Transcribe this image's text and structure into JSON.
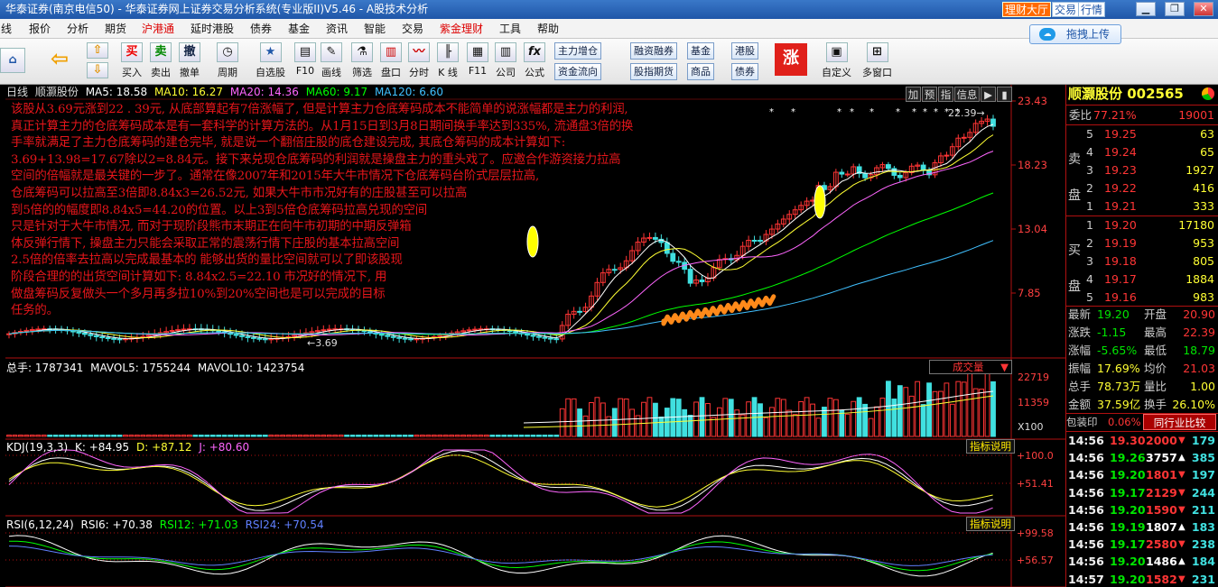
{
  "window": {
    "title": "华泰证券(南京电信50) - 华泰证券网上证券交易分析系统(专业版II)V5.46 - A股技术分析",
    "buttons": [
      "理财大厅",
      "交易",
      "行情"
    ]
  },
  "menu": [
    "线",
    "报价",
    "分析",
    "期货",
    "沪港通",
    "延时港股",
    "债券",
    "基金",
    "资讯",
    "智能",
    "交易",
    "紫金理财",
    "工具",
    "帮助"
  ],
  "upload_label": "拖拽上传",
  "toolbar": {
    "buttons": [
      "买入",
      "卖出",
      "撤单",
      "周期",
      "自选股",
      "F10",
      "画线",
      "筛选",
      "盘口",
      "分时",
      "K 线",
      "F11",
      "公司",
      "公式",
      "自定义",
      "多窗口"
    ],
    "pills": [
      "主力增仓",
      "资金流向",
      "融资融券",
      "股指期货",
      "基金",
      "商品",
      "港股",
      "债券"
    ],
    "trade_icons": [
      "买",
      "卖",
      "撤"
    ]
  },
  "kline": {
    "period": "日线",
    "stock": "顺灏股份",
    "ma": [
      {
        "label": "MA5: 18.58",
        "color": "#ffffff"
      },
      {
        "label": "MA10: 16.27",
        "color": "#ffff33"
      },
      {
        "label": "MA20: 14.36",
        "color": "#ff66ff"
      },
      {
        "label": "MA60: 9.17",
        "color": "#00ff00"
      },
      {
        "label": "MA120: 6.60",
        "color": "#40c0ff"
      }
    ],
    "top_buttons": [
      "加",
      "预",
      "指",
      "信息"
    ],
    "price_axis": [
      "23.43",
      "18.23",
      "13.04",
      "7.85"
    ],
    "high_label": "22.39",
    "low_label": "3.69"
  },
  "annotation": [
    "该股从3.69元涨到22 . 39元, 从底部算起有7倍涨幅了, 但是计算主力仓底筹码成本不能简单的说涨幅都是主力的利润,",
    "真正计算主力的仓底筹码成本是有一套科学的计算方法的。从1月15日到3月8日期间换手率达到335%, 流通盘3倍的换",
    "手率就满足了主力仓底筹码的建仓完毕, 就是说一个翻倍庄股的底仓建设完成, 其底仓筹码的成本计算如下:",
    "3.69+13.98=17.67除以2=8.84元。接下来兑现仓底筹码的利润就是操盘主力的重头戏了。应邀合作游资接力拉高",
    "空间的倍幅就是最关键的一步了。通常在像2007年和2015年大牛市情况下仓底筹码台阶式层层拉高,",
    "仓底筹码可以拉高至3倍即8.84x3=26.52元, 如果大牛市市况好有的庄股甚至可以拉高",
    "到5倍的的幅度即8.84x5=44.20的位置。以上3到5倍仓底筹码拉高兑现的空间",
    "只是针对于大牛市情况, 而对于现阶段熊市末期正在向牛市初期的中期反弹箱",
    "体反弹行情下, 操盘主力只能会采取正常的震荡行情下庄股的基本拉高空间",
    "2.5倍的倍率去拉高以完成最基本的 能够出货的量比空间就可以了即该股现",
    "阶段合理的的出货空间计算如下: 8.84x2.5=22.10 市况好的情况下, 用",
    "做盘筹码反复做头一个多月再多拉10%到20%空间也是可以完成的目标",
    "任务的。"
  ],
  "volume": {
    "header": [
      {
        "label": "总手: 1787341",
        "color": "#ffffff"
      },
      {
        "label": "MAVOL5: 1755244",
        "color": "#ffffff"
      },
      {
        "label": "MAVOL10: 1423754",
        "color": "#ffffff"
      }
    ],
    "button": "成交量",
    "axis": [
      "22719",
      "11359",
      "X100"
    ]
  },
  "kdj": {
    "header": [
      {
        "label": "KDJ(19,3,3)",
        "color": "#ffffff"
      },
      {
        "label": "K: +84.95",
        "color": "#ffffff"
      },
      {
        "label": "D: +87.12",
        "color": "#ffff33"
      },
      {
        "label": "J: +80.60",
        "color": "#ff66ff"
      }
    ],
    "button": "指标说明",
    "axis": [
      "100.0",
      "51.41"
    ]
  },
  "rsi": {
    "header": [
      {
        "label": "RSI(6,12,24)",
        "color": "#ffffff"
      },
      {
        "label": "RSI6: +70.38",
        "color": "#ffffff"
      },
      {
        "label": "RSI12: +71.03",
        "color": "#00ff00"
      },
      {
        "label": "RSI24: +70.54",
        "color": "#6080ff"
      }
    ],
    "button": "指标说明",
    "axis": [
      "99.58",
      "56.57"
    ]
  },
  "panel": {
    "name": "顺灏股份",
    "code": "002565",
    "wei_bi": {
      "label": "委比",
      "value": "77.21%",
      "diff": "19001"
    },
    "sell_label": [
      "卖",
      "盘"
    ],
    "buy_label": [
      "买",
      "盘"
    ],
    "sell": [
      {
        "n": "5",
        "p": "19.25",
        "v": "63"
      },
      {
        "n": "4",
        "p": "19.24",
        "v": "65"
      },
      {
        "n": "3",
        "p": "19.23",
        "v": "1927"
      },
      {
        "n": "2",
        "p": "19.22",
        "v": "416"
      },
      {
        "n": "1",
        "p": "19.21",
        "v": "333"
      }
    ],
    "buy": [
      {
        "n": "1",
        "p": "19.20",
        "v": "17180"
      },
      {
        "n": "2",
        "p": "19.19",
        "v": "953"
      },
      {
        "n": "3",
        "p": "19.18",
        "v": "805"
      },
      {
        "n": "4",
        "p": "19.17",
        "v": "1884"
      },
      {
        "n": "5",
        "p": "19.16",
        "v": "983"
      }
    ],
    "stats": [
      {
        "l1": "最新",
        "v1": "19.20",
        "c1": "green",
        "l2": "开盘",
        "v2": "20.90",
        "c2": "red"
      },
      {
        "l1": "涨跌",
        "v1": "-1.15",
        "c1": "green",
        "l2": "最高",
        "v2": "22.39",
        "c2": "red"
      },
      {
        "l1": "涨幅",
        "v1": "-5.65%",
        "c1": "green",
        "l2": "最低",
        "v2": "18.79",
        "c2": "green"
      },
      {
        "l1": "振幅",
        "v1": "17.69%",
        "c1": "yellow",
        "l2": "均价",
        "v2": "21.03",
        "c2": "red"
      },
      {
        "l1": "总手",
        "v1": "78.73万",
        "c1": "yellow",
        "l2": "量比",
        "v2": "1.00",
        "c2": "yellow"
      },
      {
        "l1": "金额",
        "v1": "37.59亿",
        "c1": "yellow",
        "l2": "换手",
        "v2": "26.10%",
        "c2": "yellow"
      }
    ],
    "bao_label": "包装印",
    "bao_value": "0.06%",
    "compare": "同行业比较",
    "ticks": [
      {
        "t": "14:56",
        "p": "19.30",
        "v": "2000",
        "pc": "red",
        "dir": "down",
        "n": "179"
      },
      {
        "t": "14:56",
        "p": "19.26",
        "v": "3757",
        "pc": "green",
        "dir": "up",
        "n": "385"
      },
      {
        "t": "14:56",
        "p": "19.20",
        "v": "1801",
        "pc": "green",
        "dir": "down",
        "n": "197"
      },
      {
        "t": "14:56",
        "p": "19.17",
        "v": "2129",
        "pc": "green",
        "dir": "down",
        "n": "244"
      },
      {
        "t": "14:56",
        "p": "19.20",
        "v": "1590",
        "pc": "green",
        "dir": "down",
        "n": "211"
      },
      {
        "t": "14:56",
        "p": "19.19",
        "v": "1807",
        "pc": "green",
        "dir": "up",
        "n": "183"
      },
      {
        "t": "14:56",
        "p": "19.17",
        "v": "2580",
        "pc": "green",
        "dir": "down",
        "n": "238"
      },
      {
        "t": "14:56",
        "p": "19.20",
        "v": "1486",
        "pc": "green",
        "dir": "up",
        "n": "184"
      },
      {
        "t": "14:57",
        "p": "19.20",
        "v": "1582",
        "pc": "green",
        "dir": "down",
        "n": "231"
      }
    ]
  }
}
